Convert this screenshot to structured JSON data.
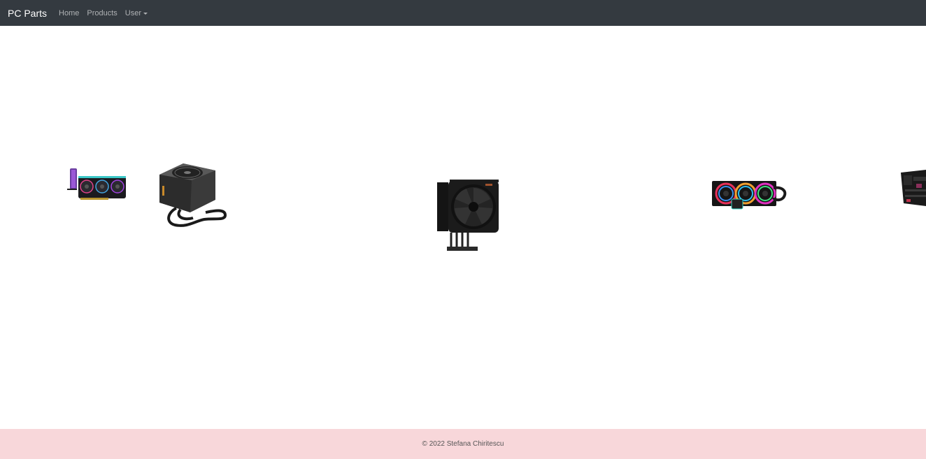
{
  "navbar": {
    "brand": "PC Parts",
    "links": [
      "Home",
      "Products"
    ],
    "user_dropdown": "User"
  },
  "products": [
    {
      "icon": "graphics-card-icon"
    },
    {
      "icon": "power-supply-icon"
    },
    {
      "icon": "cpu-cooler-icon"
    },
    {
      "icon": "liquid-cooler-icon"
    },
    {
      "icon": "motherboard-icon"
    }
  ],
  "footer": {
    "text": "© 2022 Stefana Chiritescu"
  }
}
